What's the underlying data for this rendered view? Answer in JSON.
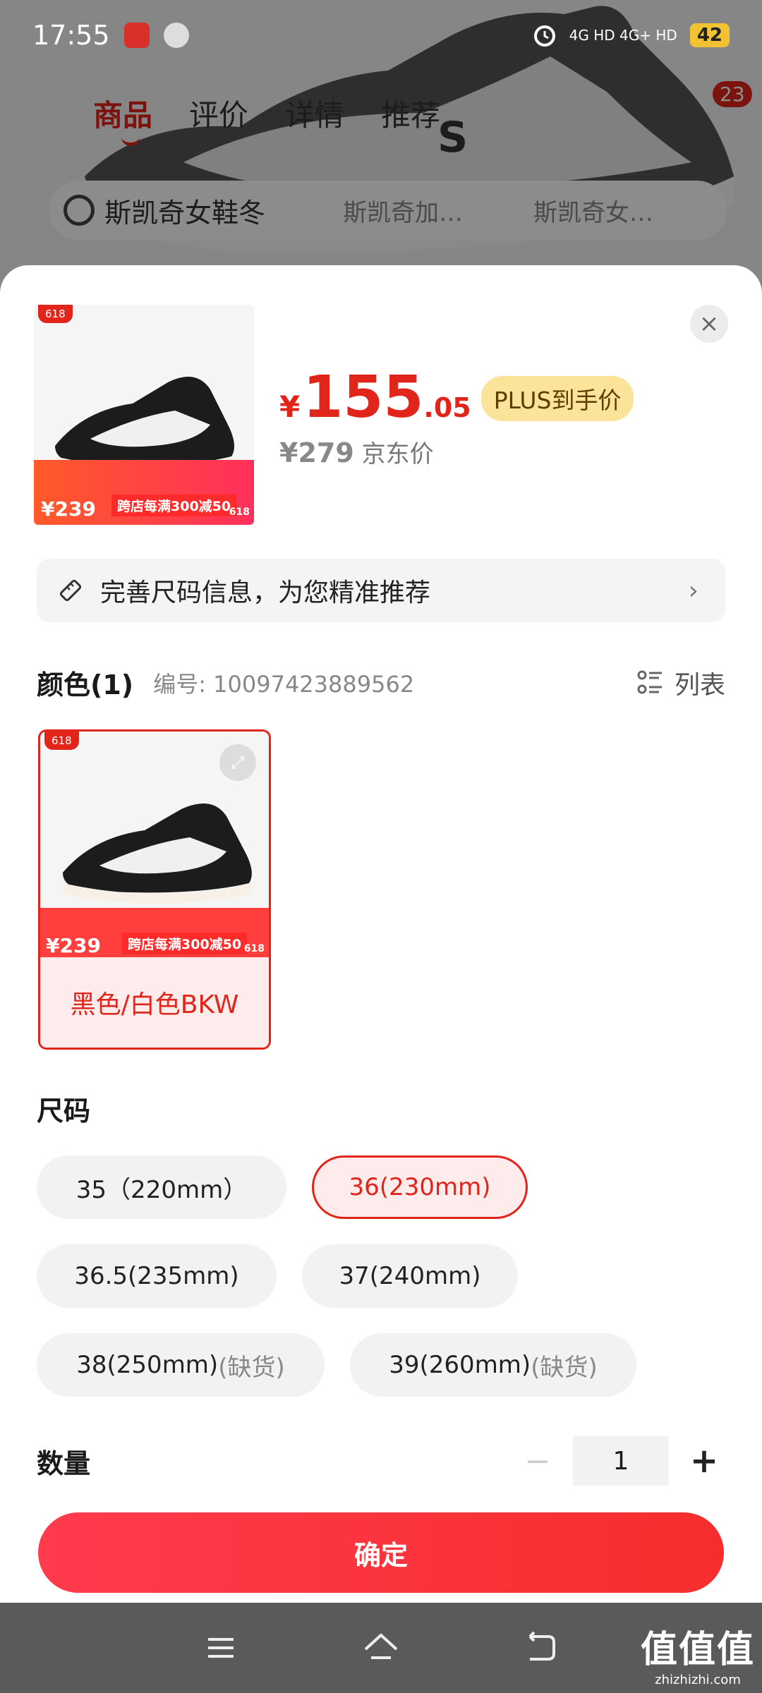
{
  "status_bar": {
    "time": "17:55",
    "network": "4G HD  4G+ HD",
    "battery": "42"
  },
  "background_page": {
    "tabs": [
      "商品",
      "评价",
      "详情",
      "推荐"
    ],
    "cart_badge": "23",
    "search_text": "斯凯奇女鞋冬",
    "search_hint_1": "斯凯奇加…",
    "search_hint_2": "斯凯奇女…"
  },
  "product": {
    "thumb_tag": "618",
    "promo_price": "¥239",
    "promo_text": "跨店每满300减50",
    "promo_618": "618",
    "price_symbol": "¥",
    "price_int": "155",
    "price_dec": ".05",
    "plus_label": "PLUS到手价",
    "orig_price": "¥279",
    "orig_label": "京东价"
  },
  "size_info": {
    "text": "完善尺码信息，为您精准推荐",
    "chevron": "›"
  },
  "color_section": {
    "title": "颜色(1)",
    "sku": "编号: 10097423889562",
    "list_label": "列表",
    "options": [
      {
        "label": "黑色/白色BKW",
        "selected": true
      }
    ]
  },
  "size_section": {
    "title": "尺码",
    "options": [
      {
        "label": "35（220mm）",
        "oos": "",
        "selected": false
      },
      {
        "label": "36(230mm)",
        "oos": "",
        "selected": true
      },
      {
        "label": "36.5(235mm)",
        "oos": "",
        "selected": false
      },
      {
        "label": "37(240mm)",
        "oos": "",
        "selected": false
      },
      {
        "label": "38(250mm)",
        "oos": "(缺货)",
        "selected": false
      },
      {
        "label": "39(260mm)",
        "oos": "(缺货)",
        "selected": false
      }
    ]
  },
  "quantity": {
    "label": "数量",
    "minus": "−",
    "value": "1",
    "plus": "+"
  },
  "confirm_label": "确定",
  "watermark": {
    "main": "值值值",
    "sub": "zhizhizhi.com"
  },
  "colors": {
    "accent": "#e1251b",
    "plus_badge": "#fbe39a"
  }
}
